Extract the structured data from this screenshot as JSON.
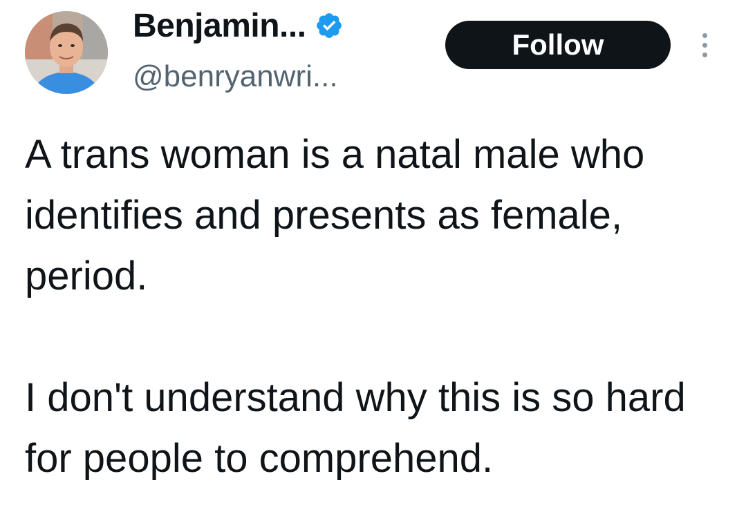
{
  "author": {
    "display_name": "Benjamin...",
    "handle": "@benryanwri...",
    "verified": true,
    "verified_color": "#1d9bf0",
    "avatar_icon": "avatar-photo"
  },
  "actions": {
    "follow_label": "Follow",
    "more_icon": "more-vertical-icon"
  },
  "tweet": {
    "paragraph_1": "A trans woman is a natal male who identifies and presents as female, period.",
    "paragraph_2": "I don't understand why this is so hard for people to comprehend."
  },
  "colors": {
    "text": "#0f1419",
    "secondary_text": "#536471",
    "follow_bg": "#0f1419",
    "follow_text": "#ffffff",
    "background": "#ffffff"
  }
}
